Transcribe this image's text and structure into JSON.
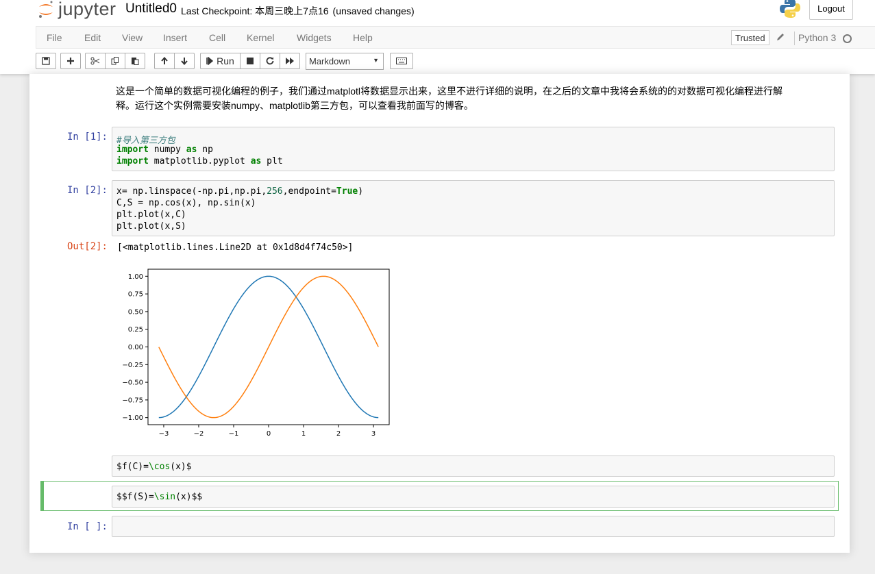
{
  "header": {
    "logo_text": "jupyter",
    "notebook_name": "Untitled0",
    "checkpoint_label": "Last Checkpoint: 本周三晚上7点16",
    "checkpoint_status": "(unsaved changes)",
    "logout": "Logout"
  },
  "menu": {
    "items": [
      "File",
      "Edit",
      "View",
      "Insert",
      "Cell",
      "Kernel",
      "Widgets",
      "Help"
    ],
    "trusted": "Trusted",
    "kernel": "Python 3"
  },
  "toolbar": {
    "run_label": "Run",
    "cell_type": "Markdown",
    "icons": [
      "save-icon",
      "plus-icon",
      "cut-icon",
      "copy-icon",
      "paste-icon",
      "arrow-up-icon",
      "arrow-down-icon",
      "run-icon",
      "stop-icon",
      "restart-icon",
      "fast-forward-icon",
      "keyboard-icon"
    ]
  },
  "cells": {
    "markdown_intro_line1": "这是一个简单的数据可视化编程的例子，我们通过matplotl将数据显示出来，这里不进行详细的说明，在之后的文章中我将会系统的的对数据可视化编程进行解",
    "markdown_intro_line2": "释。运行这个实例需要安装numpy、matplotlib第三方包，可以查看我前面写的博客。",
    "cell1_prompt": "In [1]:",
    "cell2_prompt": "In [2]:",
    "out2_prompt": "Out[2]:",
    "out2_text": "[<matplotlib.lines.Line2D at 0x1d8d4f74c50>]",
    "md_cell_f_c": "$f(C)=\\cos(x)$",
    "md_cell_f_s": "$$f(S)=\\sin(x)$$",
    "empty_prompt": "In [ ]:"
  },
  "chart_data": {
    "type": "line",
    "xlim": [
      -3.45,
      3.45
    ],
    "ylim": [
      -1.1,
      1.1
    ],
    "xticks": [
      -3,
      -2,
      -1,
      0,
      1,
      2,
      3
    ],
    "xtick_labels": [
      "−3",
      "−2",
      "−1",
      "0",
      "1",
      "2",
      "3"
    ],
    "yticks": [
      1.0,
      0.75,
      0.5,
      0.25,
      0.0,
      -0.25,
      -0.5,
      -0.75,
      -1.0
    ],
    "ytick_labels": [
      "1.00",
      "0.75",
      "0.50",
      "0.25",
      "0.00",
      "−0.25",
      "−0.50",
      "−0.75",
      "−1.00"
    ],
    "grid": false,
    "series": [
      {
        "color": "#1f77b4",
        "function": "cos",
        "x": [
          -3.14,
          -2.5,
          -2.0,
          -1.5,
          -1.0,
          -0.5,
          0.0,
          0.5,
          1.0,
          1.5,
          2.0,
          2.5,
          3.14
        ],
        "y": [
          -1.0,
          -0.8,
          -0.42,
          0.07,
          0.54,
          0.88,
          1.0,
          0.88,
          0.54,
          0.07,
          -0.42,
          -0.8,
          -1.0
        ]
      },
      {
        "color": "#ff7f0e",
        "function": "sin",
        "x": [
          -3.14,
          -2.5,
          -2.0,
          -1.5,
          -1.0,
          -0.5,
          0.0,
          0.5,
          1.0,
          1.5,
          2.0,
          2.5,
          3.14
        ],
        "y": [
          0.0,
          -0.6,
          -0.91,
          -1.0,
          -0.84,
          -0.48,
          0.0,
          0.48,
          0.84,
          1.0,
          0.91,
          0.6,
          0.0
        ]
      }
    ]
  }
}
